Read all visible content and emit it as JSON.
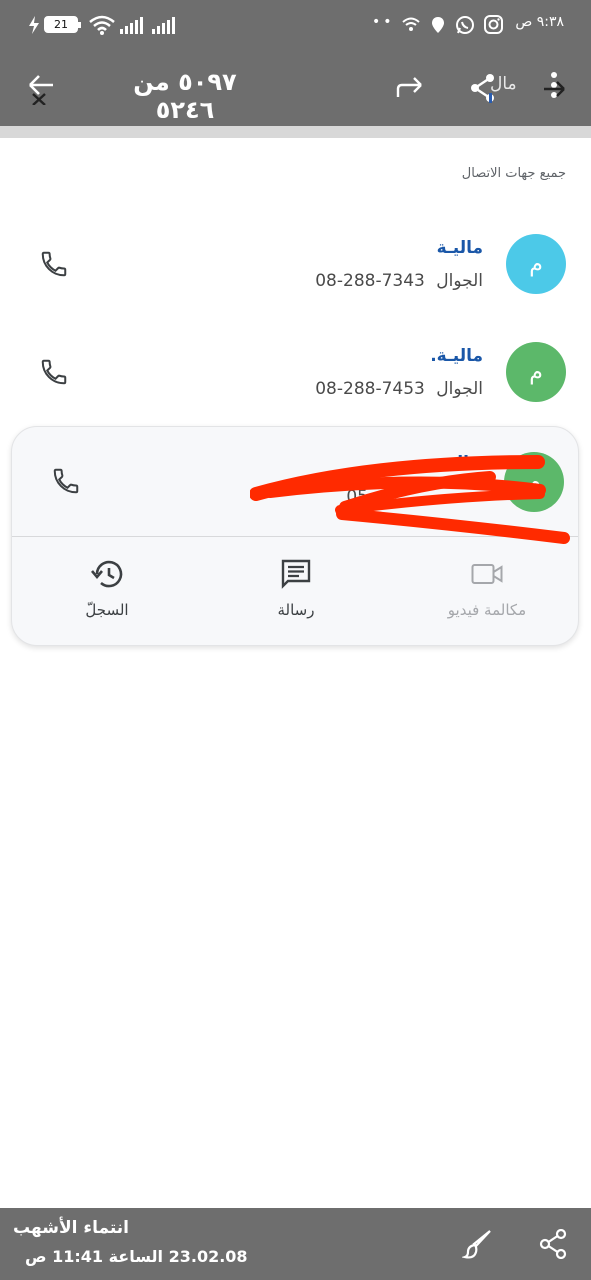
{
  "status_bar": {
    "time": "٩:٣٨ ص",
    "battery": "21",
    "icons": [
      "charging-icon",
      "wifi-icon",
      "signal-icon",
      "instagram-icon",
      "whatsapp-icon",
      "location-icon",
      "hotspot-icon",
      "more-icon"
    ]
  },
  "app_bar": {
    "title": "٥٠٩٧ من ٥٢٤٦",
    "peek_text": "مال"
  },
  "list": {
    "section_header": "جميع جهات الاتصال",
    "contacts": [
      {
        "initial": "م",
        "name": "ماليـة",
        "label": "الجوال",
        "phone": "08-288-7343",
        "avatar_color": "#4cc9e8"
      },
      {
        "initial": "م",
        "name": "ماليـة.",
        "label": "الجوال",
        "phone": "08-288-7453",
        "avatar_color": "#5cb86a"
      },
      {
        "initial": "م",
        "name": "ماليـة",
        "label": "",
        "phone": "05",
        "avatar_color": "#5cb86a"
      }
    ]
  },
  "actions": {
    "video_label": "مكالمة فيديو",
    "message_label": "رسالة",
    "history_label": "السجلّ"
  },
  "caption": {
    "title": "انتماء الأشهب",
    "date": "23.02.08 الساعة 11:41 ص"
  },
  "colors": {
    "bar_gray": "#6e6e6e",
    "name_blue": "#1a57a8",
    "redact_red": "#ff2a00"
  }
}
